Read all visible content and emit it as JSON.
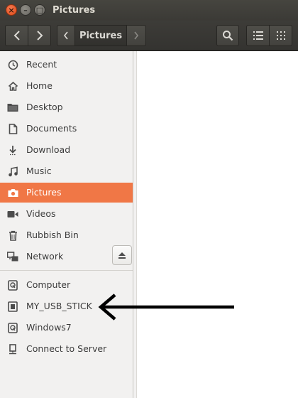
{
  "window": {
    "title": "Pictures"
  },
  "toolbar": {
    "path_current": "Pictures"
  },
  "sidebar": {
    "places": [
      {
        "label": "Recent",
        "icon": "clock-icon"
      },
      {
        "label": "Home",
        "icon": "home-icon"
      },
      {
        "label": "Desktop",
        "icon": "folder-icon"
      },
      {
        "label": "Documents",
        "icon": "document-icon"
      },
      {
        "label": "Download",
        "icon": "download-icon"
      },
      {
        "label": "Music",
        "icon": "music-icon"
      },
      {
        "label": "Pictures",
        "icon": "camera-icon",
        "active": true
      },
      {
        "label": "Videos",
        "icon": "video-icon"
      },
      {
        "label": "Rubbish Bin",
        "icon": "trash-icon"
      },
      {
        "label": "Network",
        "icon": "network-icon"
      }
    ],
    "devices": [
      {
        "label": "Computer",
        "icon": "drive-icon"
      },
      {
        "label": "MY_USB_STICK",
        "icon": "usb-drive-icon"
      },
      {
        "label": "Windows7",
        "icon": "drive-icon"
      },
      {
        "label": "Connect to Server",
        "icon": "server-icon"
      }
    ]
  },
  "colors": {
    "accent": "#f07746",
    "titlebar": "#3c3b37",
    "sidebar_bg": "#f2f1f0"
  }
}
